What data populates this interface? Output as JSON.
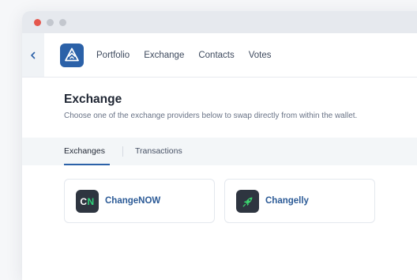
{
  "window": {
    "controls": [
      "close",
      "minimize",
      "maximize"
    ]
  },
  "nav": {
    "back_icon": "chevron-left-icon",
    "logo_icon": "wallet-logo-icon",
    "links": [
      "Portfolio",
      "Exchange",
      "Contacts",
      "Votes"
    ]
  },
  "page": {
    "title": "Exchange",
    "subtitle": "Choose one of the exchange providers below to swap directly from within the wallet."
  },
  "tabs": [
    {
      "label": "Exchanges",
      "active": true
    },
    {
      "label": "Transactions",
      "active": false
    }
  ],
  "providers": [
    {
      "name": "ChangeNOW",
      "logo": {
        "c": "C",
        "n": "N"
      },
      "icon": "changenow-logo-icon"
    },
    {
      "name": "Changelly",
      "icon": "changelly-rocket-icon"
    }
  ],
  "colors": {
    "accent": "#2b61a8",
    "changenow_green": "#2fd37b",
    "changelly_green": "#3bd26e"
  }
}
